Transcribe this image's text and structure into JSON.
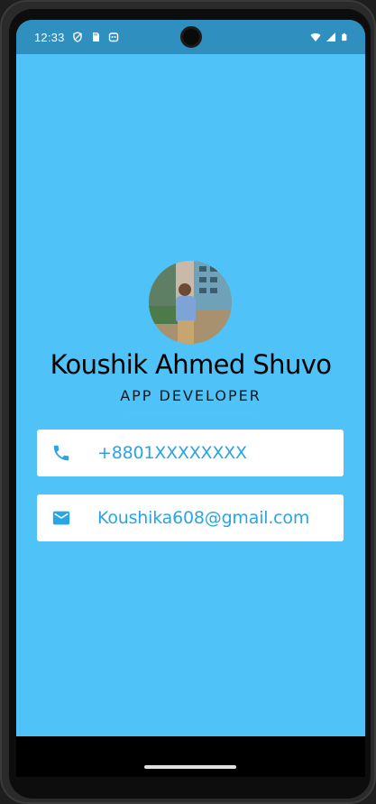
{
  "status_bar": {
    "time": "12:33",
    "left_icons": [
      "shield-icon",
      "sd-card-icon",
      "app-notification-icon"
    ],
    "right_icons": [
      "wifi-icon",
      "signal-icon",
      "battery-icon"
    ]
  },
  "profile": {
    "name": "Koushik Ahmed Shuvo",
    "title": "APP DEVELOPER"
  },
  "contacts": [
    {
      "icon": "phone-icon",
      "value": "+8801XXXXXXXX"
    },
    {
      "icon": "email-icon",
      "value": "Koushika608@gmail.com"
    }
  ],
  "colors": {
    "background": "#4fc3f7",
    "status_bar": "#2f8fbf",
    "card": "#ffffff",
    "accent": "#2aa5e3"
  }
}
